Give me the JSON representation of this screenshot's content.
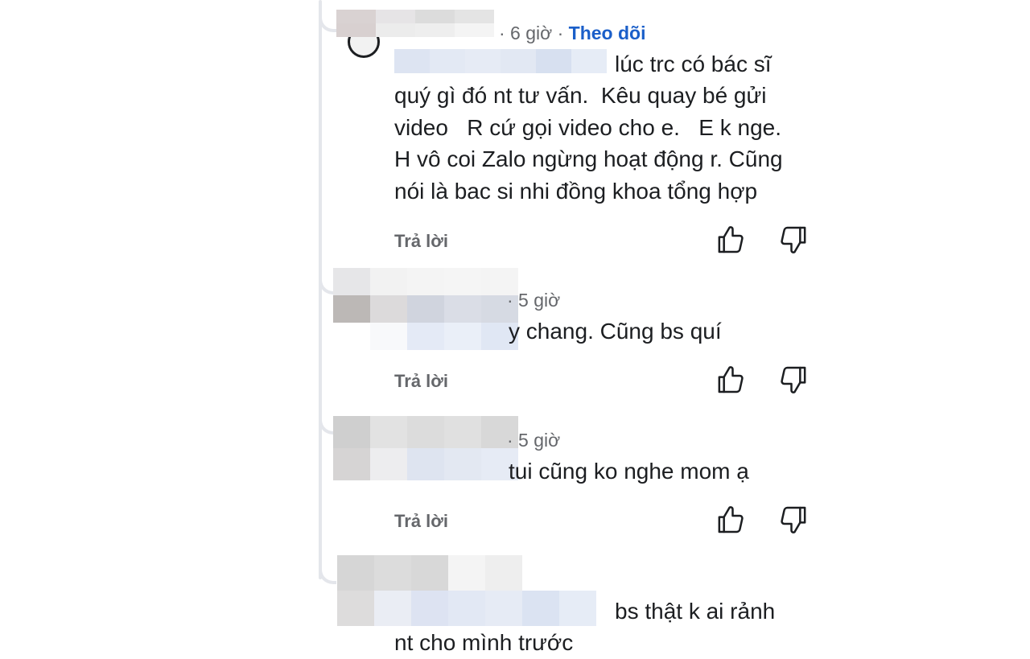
{
  "comments": [
    {
      "time": "· 6 giờ ·",
      "follow_label": "Theo dõi",
      "lines": [
        "lúc trc có bác sĩ",
        "quý gì đó nt tư vấn.  Kêu quay bé gửi",
        "video   R cứ gọi video cho e.   E k nge.",
        "H vô coi Zalo ngừng hoạt động r. Cũng",
        "nói là bac si nhi đồng khoa tổng hợp"
      ],
      "reply_label": "Trả lời"
    },
    {
      "time": "· 5 giờ",
      "lines": [
        "y chang. Cũng bs quí"
      ],
      "reply_label": "Trả lời"
    },
    {
      "time": "· 5 giờ",
      "lines": [
        "tui cũng ko nghe mom ạ"
      ],
      "reply_label": "Trả lời"
    },
    {
      "lines": [
        "bs thật k ai rảnh",
        "nt cho mình trước"
      ]
    }
  ],
  "icons": {
    "like": "thumbs-up-icon",
    "dislike": "thumbs-down-icon"
  },
  "colors": {
    "follow": "#1b5fc9",
    "meta": "#65676b",
    "text": "#1c1e21",
    "thread": "#e4e6eb"
  }
}
